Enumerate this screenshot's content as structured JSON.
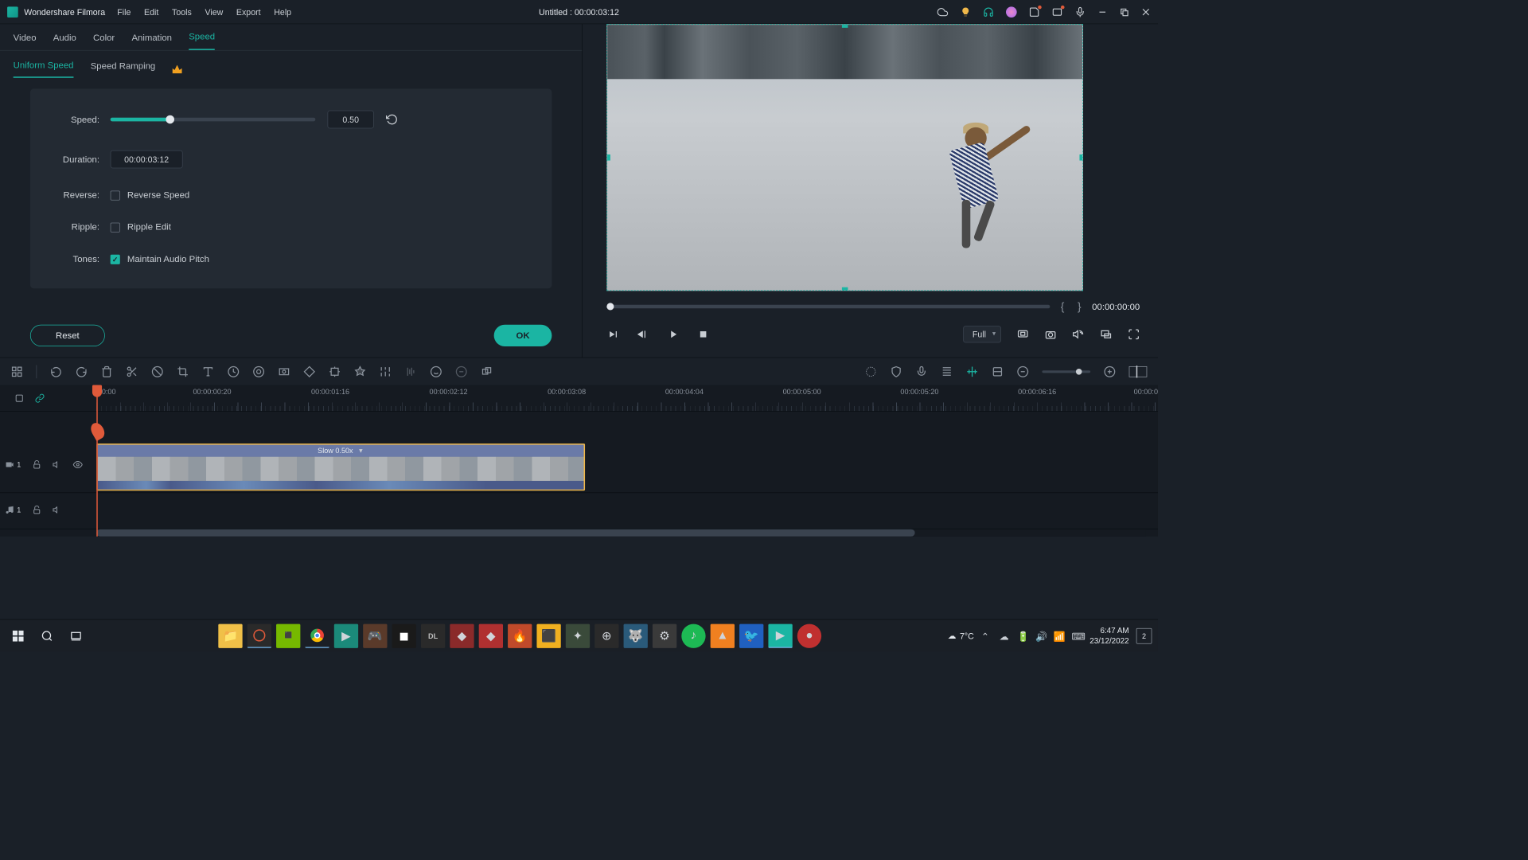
{
  "app_name": "Wondershare Filmora",
  "menu": [
    "File",
    "Edit",
    "Tools",
    "View",
    "Export",
    "Help"
  ],
  "title": "Untitled : 00:00:03:12",
  "prop_tabs": [
    "Video",
    "Audio",
    "Color",
    "Animation",
    "Speed"
  ],
  "prop_active": 4,
  "sub_tabs": {
    "uniform": "Uniform Speed",
    "ramping": "Speed Ramping"
  },
  "speed": {
    "label": "Speed:",
    "value": "0.50",
    "duration_label": "Duration:",
    "duration": "00:00:03:12",
    "reverse_label": "Reverse:",
    "reverse_check": "Reverse Speed",
    "ripple_label": "Ripple:",
    "ripple_check": "Ripple Edit",
    "tones_label": "Tones:",
    "tones_check": "Maintain Audio Pitch"
  },
  "buttons": {
    "reset": "Reset",
    "ok": "OK"
  },
  "preview": {
    "timecode": "00:00:00:00",
    "zoom": "Full"
  },
  "ruler_marks": [
    "00:00",
    "00:00:00:20",
    "00:00:01:16",
    "00:00:02:12",
    "00:00:03:08",
    "00:00:04:04",
    "00:00:05:00",
    "00:00:05:20",
    "00:00:06:16",
    "00:00:0"
  ],
  "clip": {
    "label": "Slow 0.50x"
  },
  "tracks": {
    "video": "1",
    "audio": "1"
  },
  "taskbar": {
    "weather": "7°C",
    "time": "6:47 AM",
    "date": "23/12/2022",
    "notif_count": "2"
  }
}
